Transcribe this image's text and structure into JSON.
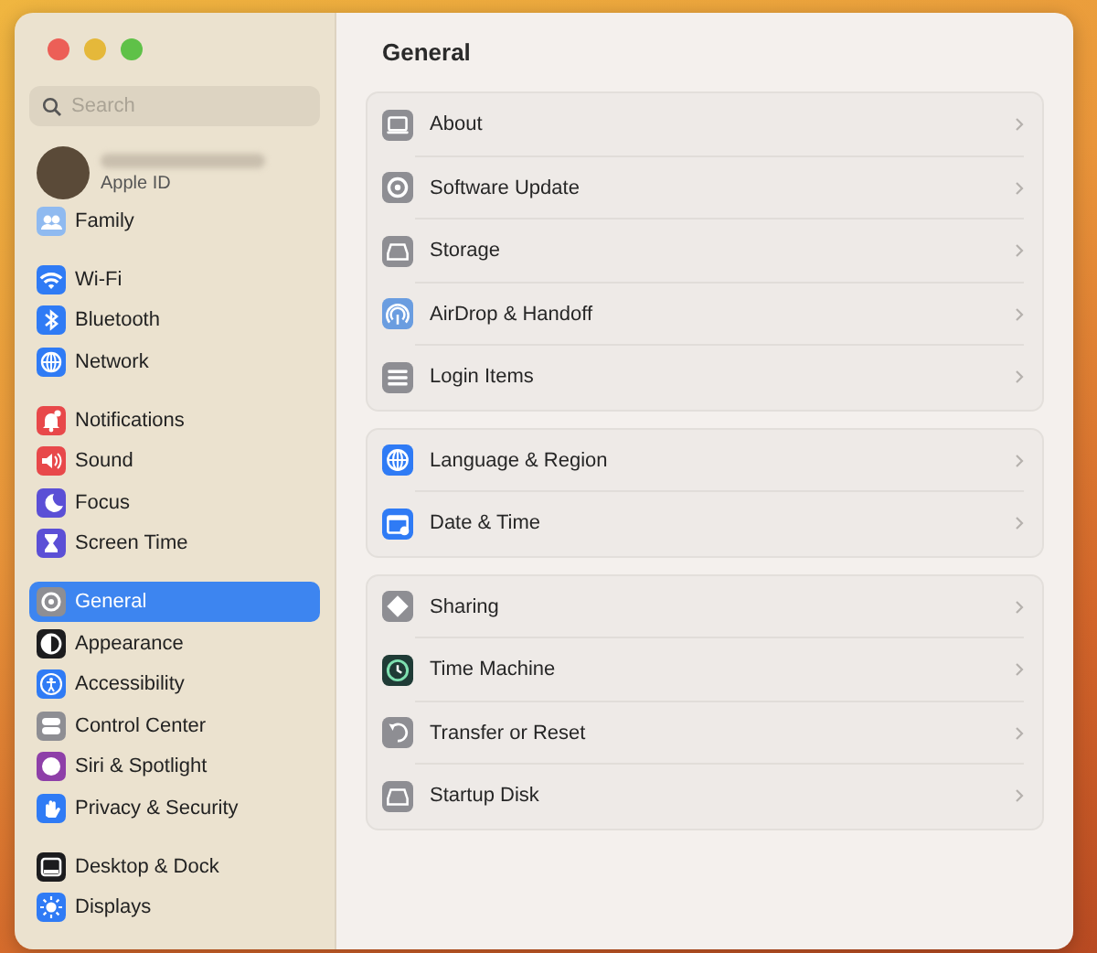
{
  "window": {
    "title": "General"
  },
  "sidebar": {
    "search": {
      "placeholder": "Search"
    },
    "account": {
      "label": "Apple ID"
    },
    "groups": [
      {
        "items": [
          {
            "label": "Family",
            "color": "#8fbaf0",
            "selected": false
          }
        ]
      },
      {
        "items": [
          {
            "label": "Wi-Fi",
            "color": "#2f7bf5",
            "selected": false
          },
          {
            "label": "Bluetooth",
            "color": "#2f7bf5",
            "selected": false
          },
          {
            "label": "Network",
            "color": "#2f7bf5",
            "selected": false
          }
        ]
      },
      {
        "items": [
          {
            "label": "Notifications",
            "color": "#e8484a",
            "selected": false
          },
          {
            "label": "Sound",
            "color": "#e8484a",
            "selected": false
          },
          {
            "label": "Focus",
            "color": "#5b4fd6",
            "selected": false
          },
          {
            "label": "Screen Time",
            "color": "#5b4fd6",
            "selected": false
          }
        ]
      },
      {
        "items": [
          {
            "label": "General",
            "color": "#8e8e93",
            "selected": true
          },
          {
            "label": "Appearance",
            "color": "#1c1c1e",
            "selected": false
          },
          {
            "label": "Accessibility",
            "color": "#2f7bf5",
            "selected": false
          },
          {
            "label": "Control Center",
            "color": "#8e8e93",
            "selected": false
          },
          {
            "label": "Siri & Spotlight",
            "color": "#8e3fa8",
            "selected": false
          },
          {
            "label": "Privacy & Security",
            "color": "#2f7bf5",
            "selected": false
          }
        ]
      },
      {
        "items": [
          {
            "label": "Desktop & Dock",
            "color": "#1c1c1e",
            "selected": false
          },
          {
            "label": "Displays",
            "color": "#2f7bf5",
            "selected": false
          }
        ]
      }
    ]
  },
  "sections": [
    {
      "rows": [
        {
          "label": "About",
          "color": "#8e8e93"
        },
        {
          "label": "Software Update",
          "color": "#8e8e93"
        },
        {
          "label": "Storage",
          "color": "#8e8e93"
        },
        {
          "label": "AirDrop & Handoff",
          "color": "#6a9de0"
        },
        {
          "label": "Login Items",
          "color": "#8e8e93"
        }
      ]
    },
    {
      "rows": [
        {
          "label": "Language & Region",
          "color": "#2f7bf5"
        },
        {
          "label": "Date & Time",
          "color": "#2f7bf5"
        }
      ]
    },
    {
      "rows": [
        {
          "label": "Sharing",
          "color": "#8e8e93"
        },
        {
          "label": "Time Machine",
          "color": "#1f3b36"
        },
        {
          "label": "Transfer or Reset",
          "color": "#8e8e93"
        },
        {
          "label": "Startup Disk",
          "color": "#8e8e93"
        }
      ]
    }
  ]
}
